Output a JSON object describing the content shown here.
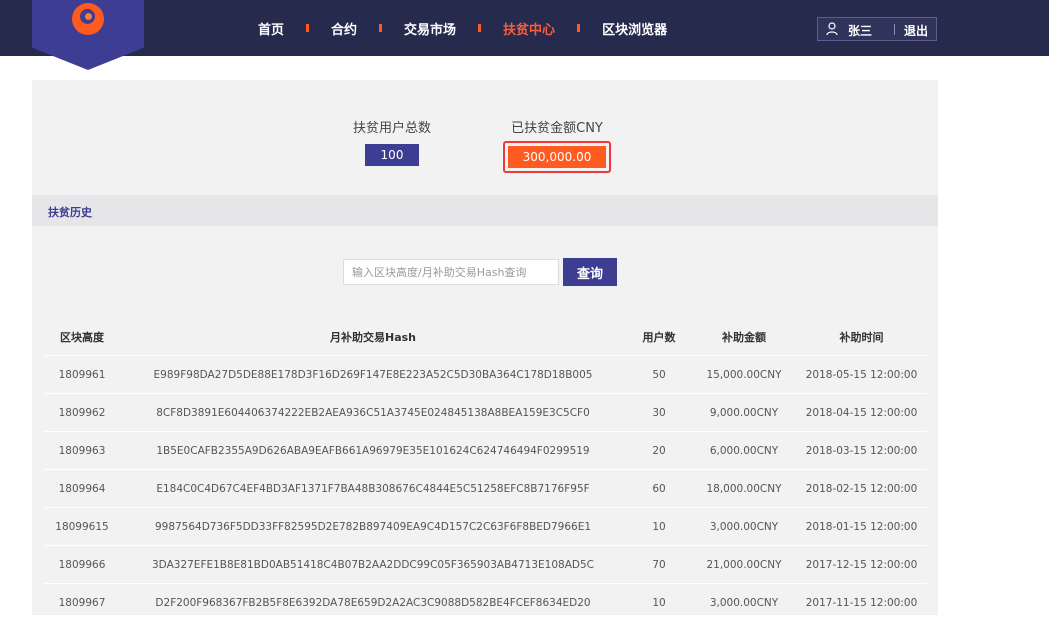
{
  "nav": {
    "items": [
      {
        "label": "首页",
        "active": false
      },
      {
        "label": "合约",
        "active": false
      },
      {
        "label": "交易市场",
        "active": false
      },
      {
        "label": "扶贫中心",
        "active": true
      },
      {
        "label": "区块浏览器",
        "active": false
      }
    ]
  },
  "user": {
    "name": "张三",
    "logout": "退出"
  },
  "stats": {
    "users_label": "扶贫用户总数",
    "users_value": "100",
    "amount_label": "已扶贫金额CNY",
    "amount_value": "300,000.00"
  },
  "section": {
    "title": "扶贫历史"
  },
  "search": {
    "placeholder": "输入区块高度/月补助交易Hash查询",
    "button": "查询"
  },
  "table": {
    "headers": [
      "区块高度",
      "月补助交易Hash",
      "用户数",
      "补助金额",
      "补助时间"
    ],
    "rows": [
      [
        "1809961",
        "E989F98DA27D5DE88E178D3F16D269F147E8E223A52C5D30BA364C178D18B005",
        "50",
        "15,000.00CNY",
        "2018-05-15 12:00:00"
      ],
      [
        "1809962",
        "8CF8D3891E604406374222EB2AEA936C51A3745E024845138A8BEA159E3C5CF0",
        "30",
        "9,000.00CNY",
        "2018-04-15 12:00:00"
      ],
      [
        "1809963",
        "1B5E0CAFB2355A9D626ABA9EAFB661A96979E35E101624C624746494F0299519",
        "20",
        "6,000.00CNY",
        "2018-03-15 12:00:00"
      ],
      [
        "1809964",
        "E184C0C4D67C4EF4BD3AF1371F7BA48B308676C4844E5C51258EFC8B7176F95F",
        "60",
        "18,000.00CNY",
        "2018-02-15 12:00:00"
      ],
      [
        "18099615",
        "9987564D736F5DD33FF82595D2E782B897409EA9C4D157C2C63F6F8BED7966E1",
        "10",
        "3,000.00CNY",
        "2018-01-15 12:00:00"
      ],
      [
        "1809966",
        "3DA327EFE1B8E81BD0AB51418C4B07B2AA2DDC99C05F365903AB4713E108AD5C",
        "70",
        "21,000.00CNY",
        "2017-12-15 12:00:00"
      ],
      [
        "1809967",
        "D2F200F968367FB2B5F8E6392DA78E659D2A2AC3C9088D582BE4FCEF8634ED20",
        "10",
        "3,000.00CNY",
        "2017-11-15 12:00:00"
      ]
    ]
  }
}
